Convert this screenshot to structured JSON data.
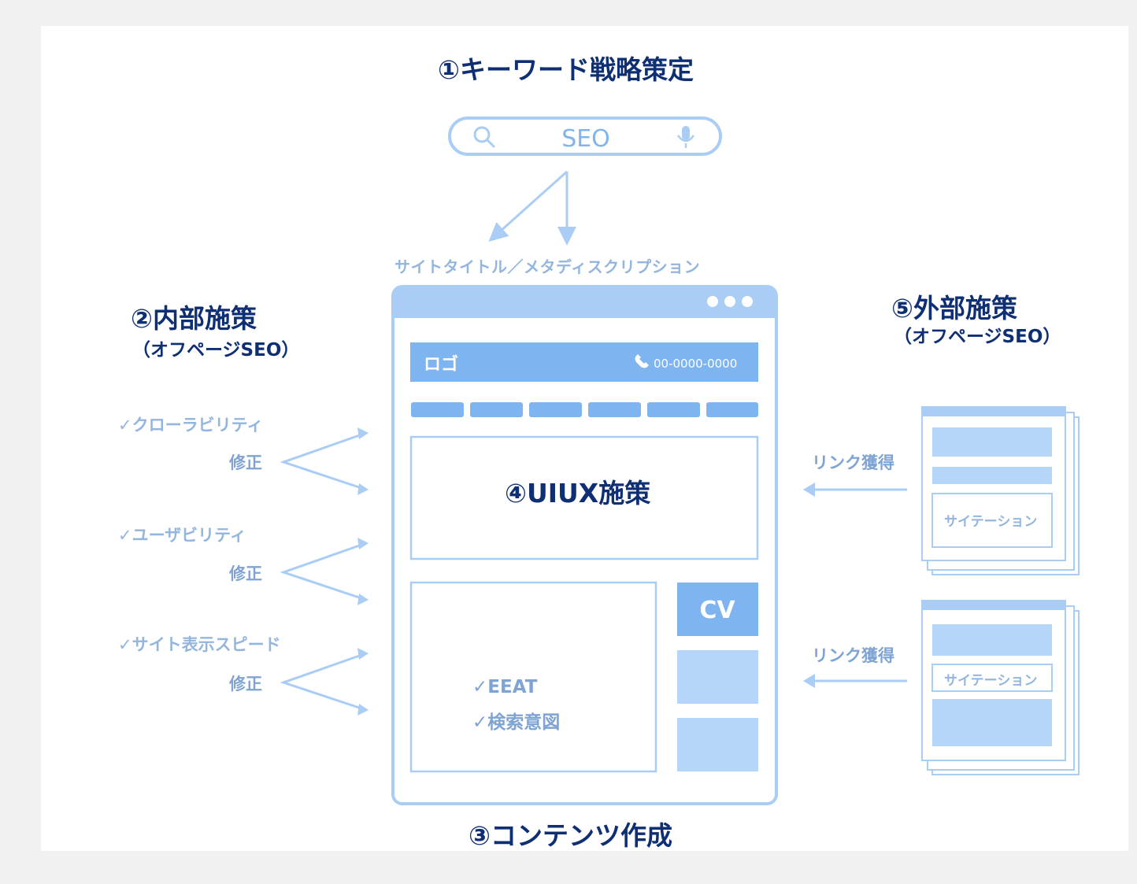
{
  "headings": {
    "keyword": "①キーワード戦略策定",
    "internal": "②内部施策",
    "internal_sub": "（オフページSEO）",
    "contents": "③コンテンツ作成",
    "uiux": "④UIUX施策",
    "external": "⑤外部施策",
    "external_sub": "（オフページSEO）"
  },
  "search": {
    "query": "SEO",
    "icon_left": "search-icon",
    "icon_right": "microphone-icon"
  },
  "meta_label": "サイトタイトル／メタディスクリプション",
  "browser": {
    "logo": "ロゴ",
    "phone": "00-0000-0000",
    "phone_icon": "phone-icon",
    "cv": "CV",
    "checks": [
      "✓EEAT",
      "✓検索意図"
    ]
  },
  "internal_items": [
    {
      "check": "✓クローラビリティ",
      "fix": "修正"
    },
    {
      "check": "✓ユーザビリティ",
      "fix": "修正"
    },
    {
      "check": "✓サイト表示スピード",
      "fix": "修正"
    }
  ],
  "external_items": [
    {
      "link": "リンク獲得",
      "citation": "サイテーション"
    },
    {
      "link": "リンク獲得",
      "citation": "サイテーション"
    }
  ],
  "colors": {
    "heading": "#0f2f74",
    "primary_blue": "#7eb4ef",
    "light_blue": "#b5d6f8",
    "frame_blue": "#a9cdf4",
    "label_blue": "#93b5de"
  }
}
